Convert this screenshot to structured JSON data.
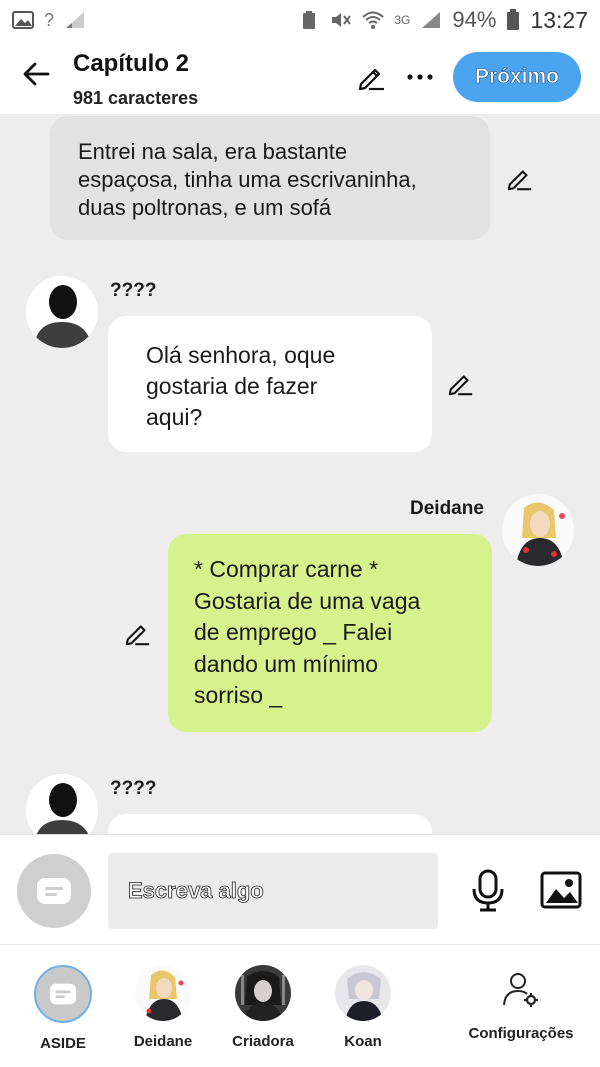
{
  "status_bar": {
    "battery_percent": "94%",
    "time": "13:27",
    "network": "3G",
    "sim": "?"
  },
  "header": {
    "title": "Capítulo 2",
    "subtitle": "981 caracteres",
    "next_label": "Próximo"
  },
  "messages": [
    {
      "type": "narration",
      "lines": [
        "Entrei na sala, era bastante",
        "espaçosa, tinha uma escrivaninha,",
        "duas poltronas, e um sofá"
      ]
    },
    {
      "type": "incoming",
      "name": "????",
      "lines": [
        "Olá senhora, oque",
        "gostaria de fazer",
        "aqui?"
      ]
    },
    {
      "type": "outgoing",
      "name": "Deidane",
      "lines": [
        "* Comprar carne *",
        "Gostaria de uma vaga",
        "de emprego _ Falei",
        "dando um mínimo",
        "sorriso _"
      ]
    },
    {
      "type": "incoming",
      "name": "????",
      "lines": []
    }
  ],
  "composer": {
    "placeholder": "Escreva algo"
  },
  "bottom_nav": [
    {
      "label": "ASIDE",
      "icon": "chat-bubble-icon"
    },
    {
      "label": "Deidane",
      "icon": "avatar"
    },
    {
      "label": "Criadora",
      "icon": "avatar"
    },
    {
      "label": "Koan",
      "icon": "avatar"
    },
    {
      "label": "Configurações",
      "icon": "user-settings-icon"
    }
  ],
  "colors": {
    "accent": "#4aa4f0",
    "outgoing_bubble": "#d6f28d",
    "incoming_bubble": "#ffffff",
    "narration_bubble": "#e2e2e2",
    "background": "#ededed"
  }
}
